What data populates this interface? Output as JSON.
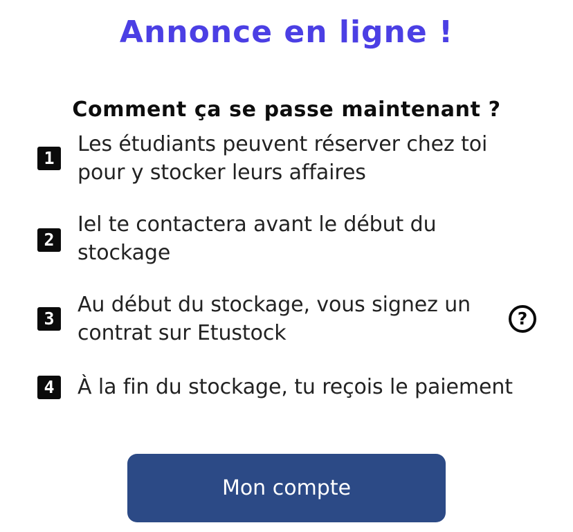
{
  "header": {
    "title": "Annonce en ligne !",
    "subtitle": "Comment ça se passe maintenant ?"
  },
  "steps": [
    {
      "number": "1",
      "text": "Les étudiants peuvent réserver chez toi pour y stocker leurs affaires"
    },
    {
      "number": "2",
      "text": "Iel te contactera avant le début du stockage"
    },
    {
      "number": "3",
      "text": "Au début du stockage, vous signez un contrat sur Etustock"
    },
    {
      "number": "4",
      "text": "À la fin du stockage, tu reçois le paiement"
    }
  ],
  "help": {
    "icon": "question-circle-icon",
    "glyph": "?"
  },
  "actions": {
    "account_label": "Mon compte"
  },
  "colors": {
    "title": "#4b3fe4",
    "button_background": "#2c4a86",
    "step_badge": "#0b0b0b"
  }
}
